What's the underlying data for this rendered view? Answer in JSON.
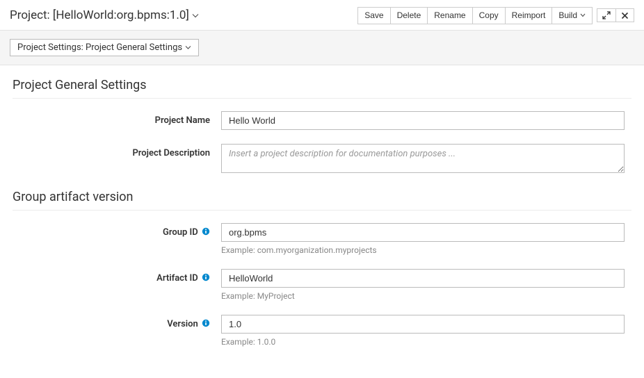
{
  "header": {
    "title": "Project: [HelloWorld:org.bpms:1.0]"
  },
  "toolbar": {
    "save": "Save",
    "delete": "Delete",
    "rename": "Rename",
    "copy": "Copy",
    "reimport": "Reimport",
    "build": "Build"
  },
  "settingsBar": {
    "label": "Project Settings: Project General Settings"
  },
  "section1": {
    "heading": "Project General Settings",
    "projectNameLabel": "Project Name",
    "projectNameValue": "Hello World",
    "projectDescLabel": "Project Description",
    "projectDescPlaceholder": "Insert a project description for documentation purposes ..."
  },
  "section2": {
    "heading": "Group artifact version",
    "groupIdLabel": "Group ID",
    "groupIdValue": "org.bpms",
    "groupIdExample": "Example: com.myorganization.myprojects",
    "artifactIdLabel": "Artifact ID",
    "artifactIdValue": "HelloWorld",
    "artifactIdExample": "Example: MyProject",
    "versionLabel": "Version",
    "versionValue": "1.0",
    "versionExample": "Example: 1.0.0"
  }
}
